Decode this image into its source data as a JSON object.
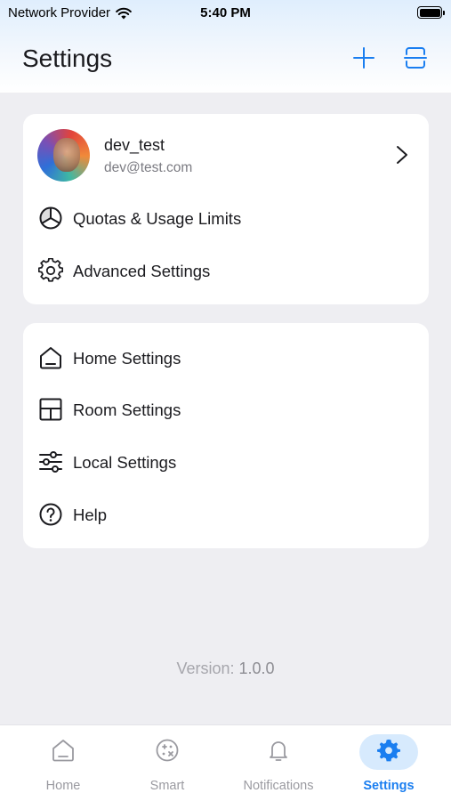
{
  "status_bar": {
    "carrier": "Network Provider",
    "time": "5:40 PM"
  },
  "header": {
    "title": "Settings"
  },
  "profile": {
    "username": "dev_test",
    "email": "dev@test.com"
  },
  "card1_items": [
    {
      "label": "Quotas & Usage Limits",
      "icon": "pie-chart-icon"
    },
    {
      "label": "Advanced Settings",
      "icon": "gear-icon"
    }
  ],
  "card2_items": [
    {
      "label": "Home Settings",
      "icon": "home-icon"
    },
    {
      "label": "Room Settings",
      "icon": "room-layout-icon"
    },
    {
      "label": "Local Settings",
      "icon": "sliders-icon"
    },
    {
      "label": "Help",
      "icon": "help-icon"
    }
  ],
  "version": {
    "label": "Version:",
    "number": "1.0.0"
  },
  "tabs": [
    {
      "label": "Home",
      "icon": "home-icon"
    },
    {
      "label": "Smart",
      "icon": "smart-icon"
    },
    {
      "label": "Notifications",
      "icon": "bell-icon"
    },
    {
      "label": "Settings",
      "icon": "gear-icon",
      "active": true
    }
  ],
  "colors": {
    "accent": "#1a7ef0",
    "active_pill": "#d7eafd",
    "background": "#eeeef2"
  }
}
